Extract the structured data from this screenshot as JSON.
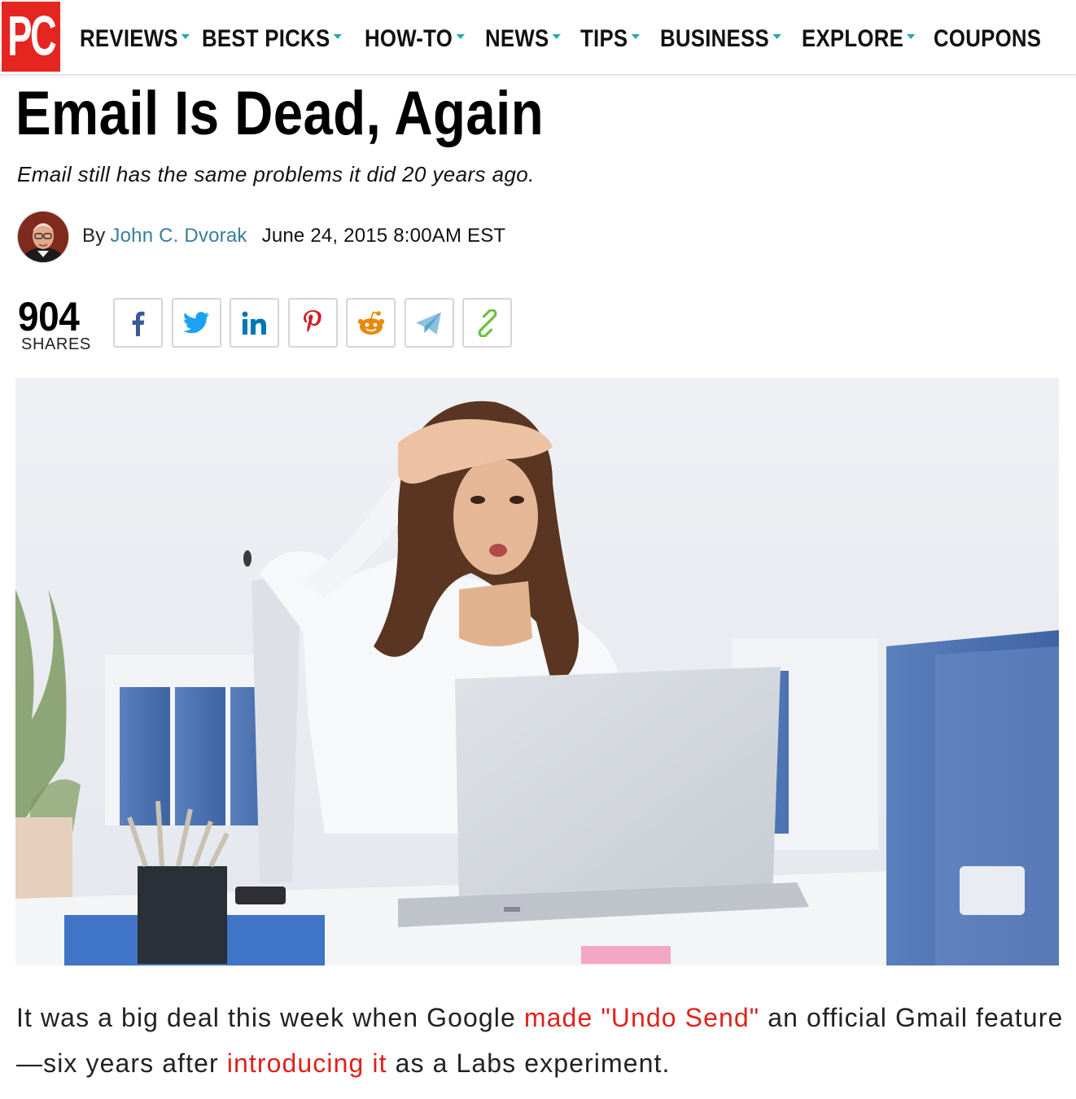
{
  "nav": {
    "logo": "PC",
    "items": [
      {
        "label": "REVIEWS",
        "has_dropdown": true
      },
      {
        "label": "BEST PICKS",
        "has_dropdown": true
      },
      {
        "label": "HOW-TO",
        "has_dropdown": true
      },
      {
        "label": "NEWS",
        "has_dropdown": true
      },
      {
        "label": "TIPS",
        "has_dropdown": true
      },
      {
        "label": "BUSINESS",
        "has_dropdown": true
      },
      {
        "label": "EXPLORE",
        "has_dropdown": true
      },
      {
        "label": "COUPONS",
        "has_dropdown": false
      }
    ],
    "caret_color": "#2aa7a8"
  },
  "article": {
    "title": "Email Is Dead, Again",
    "subtitle": "Email still has the same problems it did 20 years ago.",
    "byline_prefix": "By",
    "author": "John C. Dvorak",
    "date": "June 24, 2015 8:00AM EST"
  },
  "share": {
    "count": "904",
    "label": "SHARES",
    "buttons": [
      {
        "name": "facebook",
        "icon": "facebook-icon",
        "color": "#3b5998"
      },
      {
        "name": "twitter",
        "icon": "twitter-icon",
        "color": "#1da1f2"
      },
      {
        "name": "linkedin",
        "icon": "linkedin-icon",
        "color": "#0077b5"
      },
      {
        "name": "pinterest",
        "icon": "pinterest-icon",
        "color": "#cb2027"
      },
      {
        "name": "reddit",
        "icon": "reddit-icon",
        "color": "#e8890e"
      },
      {
        "name": "telegram",
        "icon": "telegram-icon",
        "color": "#5aa3cf"
      },
      {
        "name": "copy-link",
        "icon": "link-icon",
        "color": "#6cbf3f"
      }
    ]
  },
  "body": {
    "p1_text_1": "It was a big deal this week when Google ",
    "p1_link_1": "made \"Undo Send\"",
    "p1_text_2": " an official Gmail feature—six years after ",
    "p1_link_2": "introducing it",
    "p1_text_3": " as a Labs experiment.",
    "link_color": "#e0211c"
  },
  "colors": {
    "brand_red": "#e5251f",
    "author_link": "#3b7d9b"
  }
}
